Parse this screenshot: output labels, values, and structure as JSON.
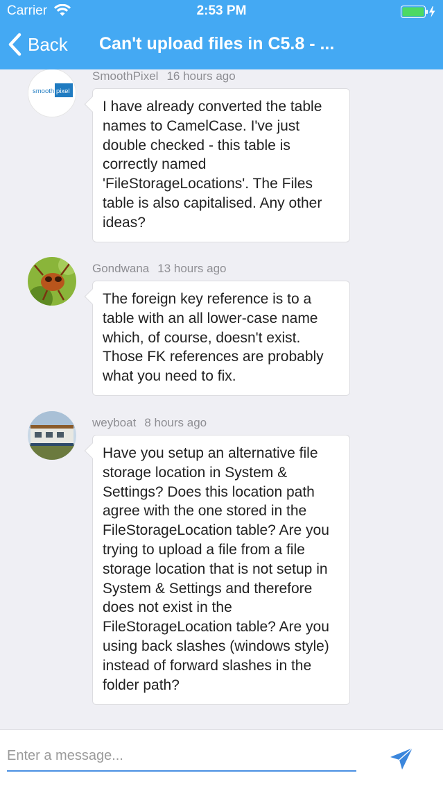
{
  "status_bar": {
    "carrier": "Carrier",
    "time": "2:53 PM"
  },
  "nav": {
    "back_label": "Back",
    "title": "Can't upload files in C5.8 - ..."
  },
  "messages": [
    {
      "author": "SmoothPixel",
      "time_ago": "16 hours ago",
      "avatar_text": [
        "smooth",
        "pixel"
      ],
      "text": "I have already converted the table names to CamelCase. I've just double checked - this table is correctly named 'FileStorageLocations'. The Files table is also capitalised. Any other ideas?"
    },
    {
      "author": "Gondwana",
      "time_ago": "13 hours ago",
      "text": "The foreign key reference is to a table with an all lower-case name which, of course, doesn't exist. Those FK references are probably what you need to fix."
    },
    {
      "author": "weyboat",
      "time_ago": "8 hours ago",
      "text": "Have you setup an alternative file storage location in System & Settings? Does this location path agree with the one stored in the FileStorageLocation table? Are you trying to upload a file from a file storage location that is not setup in System & Settings and therefore does not exist in the FileStorageLocation table? Are you using back slashes (windows style) instead of forward slashes in the folder path?"
    }
  ],
  "composer": {
    "placeholder": "Enter a message..."
  },
  "colors": {
    "header": "#44a9f3",
    "accent": "#4a90e2",
    "battery": "#4cd964"
  }
}
